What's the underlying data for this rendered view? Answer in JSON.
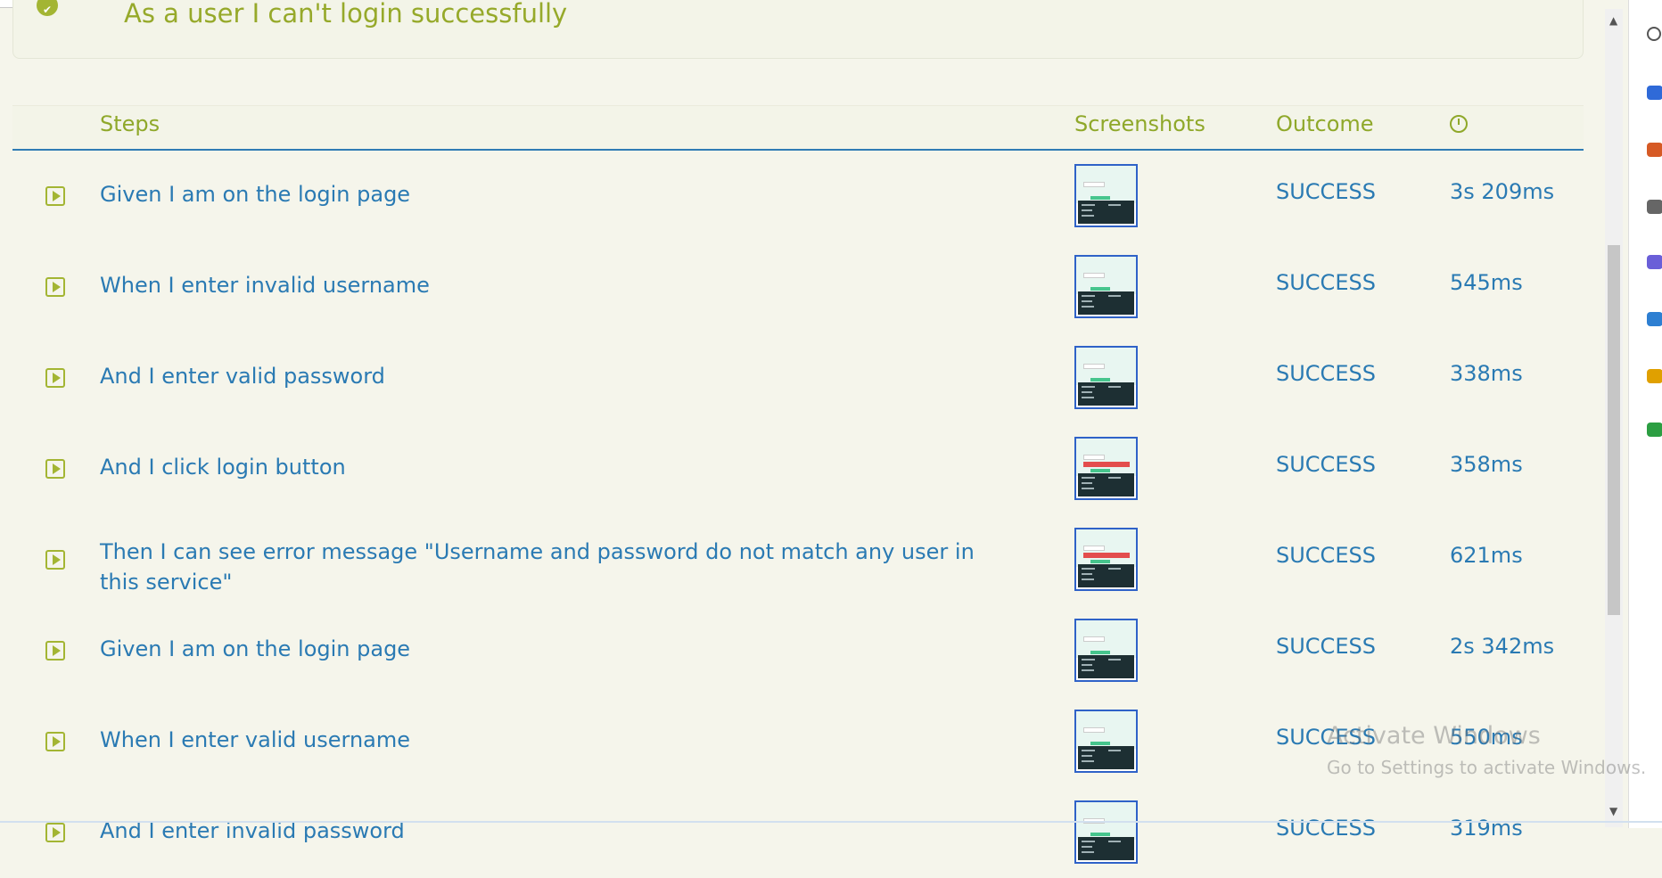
{
  "scenario": {
    "title": "As a user I can't login successfully"
  },
  "table": {
    "headers": {
      "steps": "Steps",
      "screenshots": "Screenshots",
      "outcome": "Outcome"
    },
    "rows": [
      {
        "step": "Given I am on the login page",
        "outcome": "SUCCESS",
        "duration": "3s 209ms",
        "shot": "login"
      },
      {
        "step": "When I enter invalid username",
        "outcome": "SUCCESS",
        "duration": "545ms",
        "shot": "login"
      },
      {
        "step": "And I enter valid password",
        "outcome": "SUCCESS",
        "duration": "338ms",
        "shot": "login"
      },
      {
        "step": "And I click login button",
        "outcome": "SUCCESS",
        "duration": "358ms",
        "shot": "error"
      },
      {
        "step": "Then I can see error message \"Username and password do not match any user in this service\"",
        "outcome": "SUCCESS",
        "duration": "621ms",
        "shot": "error"
      },
      {
        "step": "Given I am on the login page",
        "outcome": "SUCCESS",
        "duration": "2s 342ms",
        "shot": "login"
      },
      {
        "step": "When I enter valid username",
        "outcome": "SUCCESS",
        "duration": "550ms",
        "shot": "login"
      },
      {
        "step": "And I enter invalid password",
        "outcome": "SUCCESS",
        "duration": "319ms",
        "shot": "login"
      }
    ]
  },
  "watermark": {
    "line1": "Activate Windows",
    "line2": "Go to Settings to activate Windows."
  },
  "icons": {
    "scenario_status": "check-circle-icon",
    "step_toggle": "play-square-icon",
    "duration_header": "clock-icon"
  }
}
